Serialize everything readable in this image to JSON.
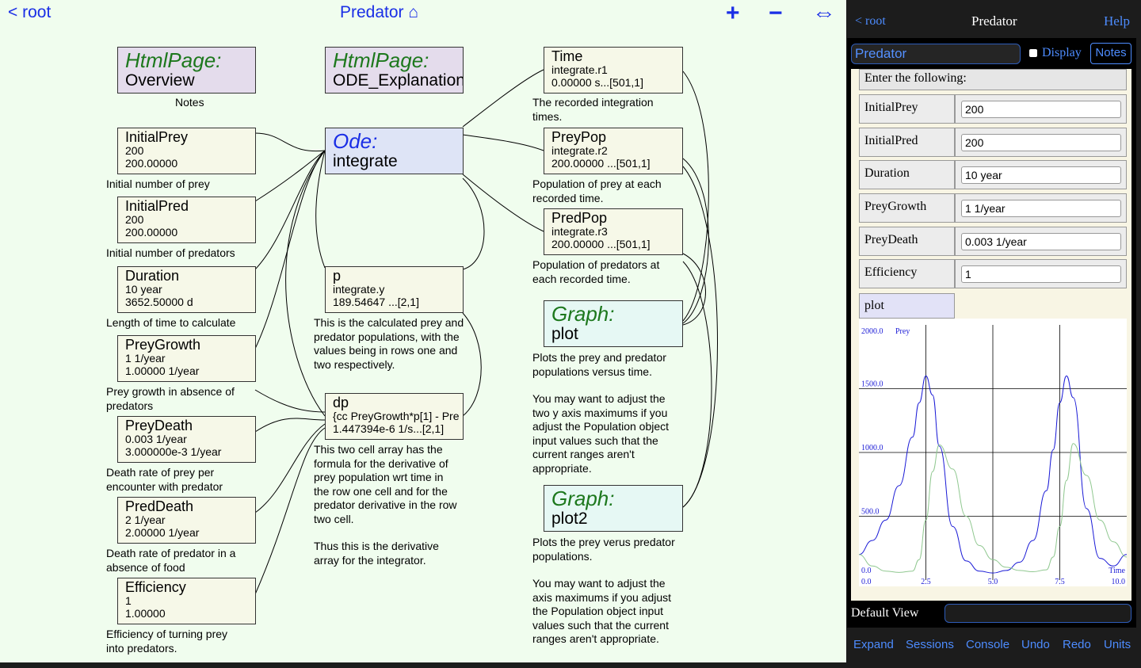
{
  "nav": {
    "back": "< root",
    "title": "Predator ⌂",
    "plus": "+",
    "minus": "−",
    "expand": "⇔"
  },
  "nodes": {
    "overview": {
      "kind": "HtmlPage:",
      "name": "Overview",
      "note": "Notes"
    },
    "ode_expl": {
      "kind": "HtmlPage:",
      "name": "ODE_Explanation"
    },
    "initialprey": {
      "name": "InitialPrey",
      "l1": "200",
      "l2": "200.00000",
      "note": "Initial number of prey"
    },
    "initialpred": {
      "name": "InitialPred",
      "l1": "200",
      "l2": "200.00000",
      "note": "Initial number of predators"
    },
    "duration": {
      "name": "Duration",
      "l1": "10 year",
      "l2": "3652.50000 d",
      "note": "Length of time to calculate"
    },
    "preygrowth": {
      "name": "PreyGrowth",
      "l1": "1 1/year",
      "l2": "1.00000 1/year",
      "note": "Prey growth in absence of predators"
    },
    "preydeath": {
      "name": "PreyDeath",
      "l1": "0.003 1/year",
      "l2": "3.000000e-3 1/year",
      "note": "Death rate of prey per encounter with predator"
    },
    "preddeath": {
      "name": "PredDeath",
      "l1": "2 1/year",
      "l2": "2.00000 1/year",
      "note": "Death rate of predator in a absence of food"
    },
    "efficiency": {
      "name": "Efficiency",
      "l1": "1",
      "l2": "1.00000",
      "note": "Efficiency of turning prey into predators."
    },
    "ode": {
      "kind": "Ode:",
      "name": "integrate"
    },
    "p": {
      "name": "p",
      "l1": "integrate.y",
      "l2": "189.54647 ...[2,1]",
      "note": "This is the calculated prey and predator populations, with the values being in rows one and two respectively."
    },
    "dp": {
      "name": "dp",
      "l1": "{cc PreyGrowth*p[1] - Pre",
      "l2": "1.447394e-6 1/s...[2,1]",
      "note1": "This two cell array has the formula for the derivative of prey population wrt time in the row one cell and for the predator derivative in the row two cell.",
      "note2": "Thus this is the derivative array for the integrator."
    },
    "time": {
      "name": "Time",
      "l1": "integrate.r1",
      "l2": "0.00000 s...[501,1]",
      "note": "The recorded integration times."
    },
    "preypop": {
      "name": "PreyPop",
      "l1": "integrate.r2",
      "l2": "200.00000 ...[501,1]",
      "note": "Population of prey at each recorded time."
    },
    "predpop": {
      "name": "PredPop",
      "l1": "integrate.r3",
      "l2": "200.00000 ...[501,1]",
      "note": "Population of predators at each recorded time."
    },
    "plot": {
      "kind": "Graph:",
      "name": "plot",
      "note1": "Plots the prey and predator populations versus time.",
      "note2": "You may want to adjust the two y axis maximums if you adjust the Population object input values such that the current ranges aren't appropriate."
    },
    "plot2": {
      "kind": "Graph:",
      "name": "plot2",
      "note1": "Plots the prey verus predator populations.",
      "note2": "You may want to adjust the axis maximums if you adjust the Population object input values such that the current ranges aren't appropriate."
    }
  },
  "panel": {
    "back": "< root",
    "title": "Predator",
    "help": "Help",
    "object_name": "Predator",
    "display_label": "Display",
    "notes_button": "Notes",
    "instruction": "Enter the following:",
    "fields": [
      {
        "label": "InitialPrey",
        "value": "200"
      },
      {
        "label": "InitialPred",
        "value": "200"
      },
      {
        "label": "Duration",
        "value": "10 year"
      },
      {
        "label": "PreyGrowth",
        "value": "1 1/year"
      },
      {
        "label": "PreyDeath",
        "value": "0.003 1/year"
      },
      {
        "label": "Efficiency",
        "value": "1"
      }
    ],
    "plot_tab": "plot",
    "default_view_label": "Default View",
    "default_view_value": "",
    "bottom": [
      "Expand",
      "Sessions",
      "Console",
      "Undo",
      "Redo",
      "Units"
    ]
  },
  "chart_data": {
    "type": "line",
    "x": [
      0,
      0.5,
      1,
      1.5,
      2,
      2.25,
      2.5,
      2.75,
      3,
      3.5,
      4,
      4.5,
      5,
      5.5,
      6,
      6.5,
      7,
      7.25,
      7.5,
      7.75,
      8,
      8.5,
      9,
      9.5,
      10
    ],
    "series": [
      {
        "name": "Prey",
        "color": "#1a1ad6",
        "values": [
          200,
          310,
          470,
          740,
          1120,
          1390,
          1600,
          1450,
          1050,
          420,
          150,
          70,
          55,
          75,
          140,
          310,
          700,
          1020,
          1390,
          1600,
          1430,
          560,
          170,
          110,
          200
        ]
      },
      {
        "color": "#90c890",
        "values": [
          200,
          110,
          70,
          60,
          70,
          160,
          470,
          850,
          1060,
          870,
          500,
          270,
          160,
          100,
          75,
          65,
          80,
          180,
          420,
          780,
          1070,
          820,
          470,
          300,
          180
        ]
      }
    ],
    "ymax_label": "2000.0",
    "yticks": [
      "500.0",
      "1000.0",
      "1500.0",
      "2000.0"
    ],
    "xticks": [
      "0.0",
      "2.5",
      "5.0",
      "7.5",
      "10.0"
    ],
    "y0_label": "0.0",
    "xlabel": "Time",
    "ylim": [
      0,
      2000
    ],
    "xlim": [
      0,
      10
    ],
    "grid": true
  }
}
